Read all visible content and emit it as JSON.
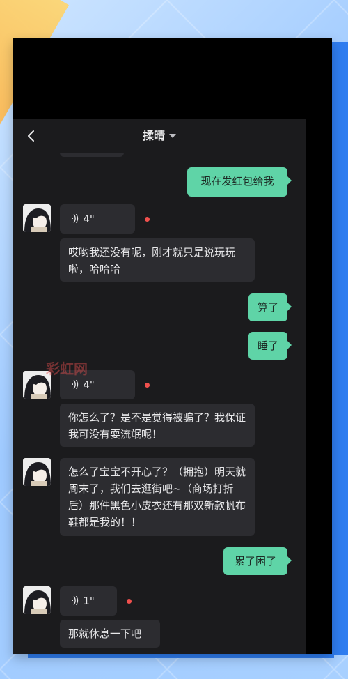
{
  "header": {
    "title": "揉晴"
  },
  "messages": [
    {
      "text": "现在发红包给我"
    },
    {
      "voice": "4\""
    },
    {
      "text": "哎哟我还没有呢，刚才就只是说玩玩啦，哈哈哈"
    },
    {
      "text": "算了"
    },
    {
      "text": "睡了"
    },
    {
      "voice": "4\""
    },
    {
      "text": "你怎么了？是不是觉得被骗了？我保证我可没有耍流氓呢！"
    },
    {
      "text": "怎么了宝宝不开心了？（拥抱）明天就周末了，我们去逛街吧~（商场打折后）那件黑色小皮衣还有那双新款帆布鞋都是我的！！"
    },
    {
      "text": "累了困了"
    },
    {
      "voice": "1\""
    },
    {
      "text": "那就休息一下吧"
    }
  ],
  "watermark": "彩虹网",
  "colors": {
    "my_bubble": "#5fd4a7",
    "their_bubble": "#2c2c30",
    "background": "#1b1b1d",
    "unread_dot": "#f0504d"
  }
}
